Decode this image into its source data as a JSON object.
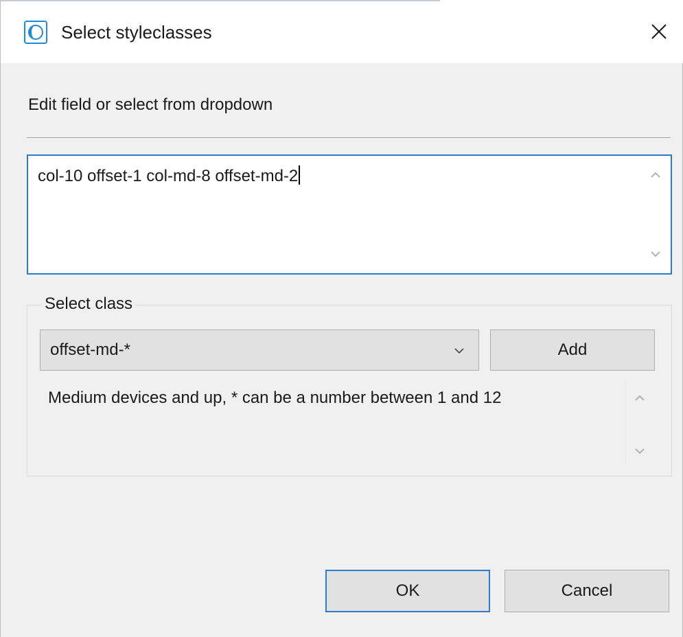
{
  "window": {
    "title": "Select styleclasses"
  },
  "instruction": "Edit field or select from dropdown",
  "styleclass_field": {
    "value": "col-10 offset-1 col-md-8 offset-md-2"
  },
  "select_group": {
    "label": "Select class",
    "dropdown_value": "offset-md-*",
    "add_label": "Add",
    "description": "Medium devices and up, * can be a number between 1 and 12"
  },
  "footer": {
    "ok_label": "OK",
    "cancel_label": "Cancel"
  },
  "icons": {
    "app": "app-logo-icon",
    "close": "close-icon",
    "scroll_up": "chevron-up-icon",
    "scroll_down": "chevron-down-icon",
    "dropdown": "chevron-down-icon"
  },
  "colors": {
    "accent": "#2a7ad0",
    "window_bg": "#f0f0f0",
    "button_bg": "#e1e1e1"
  }
}
